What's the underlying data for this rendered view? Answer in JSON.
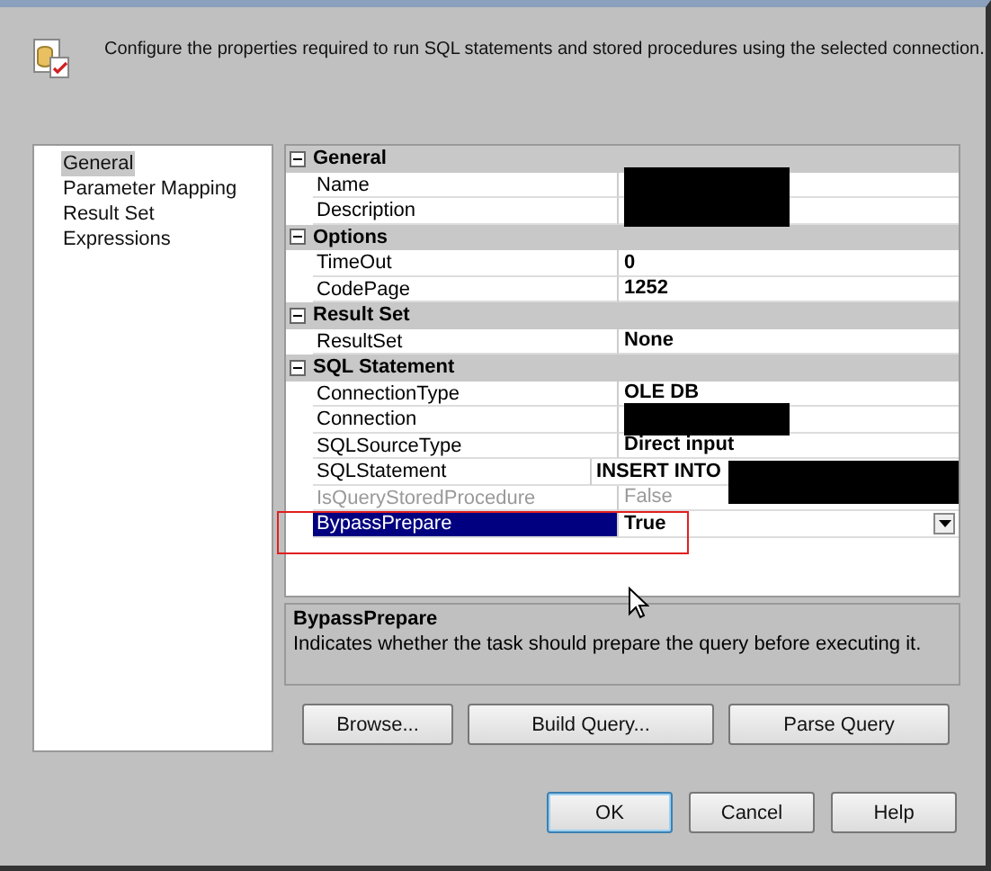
{
  "header": {
    "description": "Configure the properties required to run SQL statements and stored procedures using the selected connection."
  },
  "nav": [
    {
      "label": "General",
      "selected": true
    },
    {
      "label": "Parameter Mapping",
      "selected": false
    },
    {
      "label": "Result Set",
      "selected": false
    },
    {
      "label": "Expressions",
      "selected": false
    }
  ],
  "properties": [
    {
      "category": "General",
      "expanded": true,
      "rows": [
        {
          "name": "Name",
          "redacted": true,
          "disabled": false,
          "selected": false,
          "dropdown": false,
          "highlighted": false
        },
        {
          "name": "Description",
          "redacted": true,
          "disabled": false,
          "selected": false,
          "dropdown": false,
          "highlighted": false
        }
      ]
    },
    {
      "category": "Options",
      "expanded": true,
      "rows": [
        {
          "name": "TimeOut",
          "value": "0",
          "redacted": false,
          "disabled": false,
          "selected": false,
          "dropdown": false,
          "highlighted": false
        },
        {
          "name": "CodePage",
          "value": "1252",
          "redacted": false,
          "disabled": false,
          "selected": false,
          "dropdown": false,
          "highlighted": false
        }
      ]
    },
    {
      "category": "Result Set",
      "expanded": true,
      "rows": [
        {
          "name": "ResultSet",
          "value": "None",
          "redacted": false,
          "disabled": false,
          "selected": false,
          "dropdown": false,
          "highlighted": false
        }
      ]
    },
    {
      "category": "SQL Statement",
      "expanded": true,
      "rows": [
        {
          "name": "ConnectionType",
          "value": "OLE DB",
          "redacted": false,
          "disabled": false,
          "selected": false,
          "dropdown": false,
          "highlighted": false
        },
        {
          "name": "Connection",
          "redacted": true,
          "disabled": false,
          "selected": false,
          "dropdown": false,
          "highlighted": false
        },
        {
          "name": "SQLSourceType",
          "value": "Direct input",
          "redacted": false,
          "disabled": false,
          "selected": false,
          "dropdown": false,
          "highlighted": false
        },
        {
          "name": "SQLStatement",
          "value": "INSERT INTO",
          "redacted": true,
          "disabled": false,
          "selected": false,
          "dropdown": false,
          "highlighted": false
        },
        {
          "name": "IsQueryStoredProcedure",
          "value": "False",
          "redacted": false,
          "disabled": true,
          "selected": false,
          "dropdown": false,
          "highlighted": false
        },
        {
          "name": "BypassPrepare",
          "value": "True",
          "redacted": false,
          "disabled": false,
          "selected": true,
          "dropdown": true,
          "highlighted": true
        }
      ]
    }
  ],
  "help": {
    "title": "BypassPrepare",
    "text": "Indicates whether the task should prepare the query before executing it."
  },
  "query_buttons": [
    "Browse...",
    "Build Query...",
    "Parse Query"
  ],
  "dialog_buttons": [
    {
      "label": "OK",
      "default": true
    },
    {
      "label": "Cancel",
      "default": false
    },
    {
      "label": "Help",
      "default": false
    }
  ]
}
